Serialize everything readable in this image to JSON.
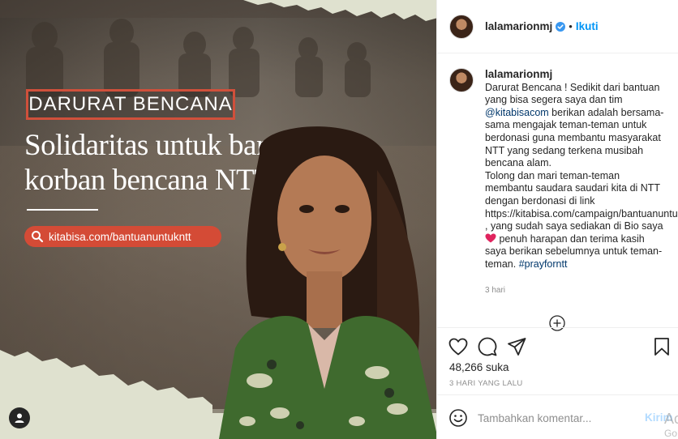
{
  "post": {
    "headline_tag": "DARURAT BENCANA",
    "headline_line1": "Solidaritas untuk bantu",
    "headline_line2": "korban bencana NTT",
    "link_pill": "kitabisa.com/bantuanuntukntt"
  },
  "header": {
    "username": "lalamarionmj",
    "separator": "•",
    "follow_label": "Ikuti"
  },
  "caption": {
    "username": "lalamarionmj",
    "text_part1": "Darurat Bencana ! Sedikit dari bantuan yang bisa segera saya dan tim ",
    "mention": "@kitabisacom",
    "text_part2": " berikan adalah bersama-sama mengajak teman-teman untuk berdonasi guna membantu masyarakat NTT yang sedang terkena musibah bencana alam.\nTolong dan mari teman-teman membantu saudara saudari kita di NTT dengan berdonasi di link https://kitabisa.com/campaign/bantuanuntukntt , yang sudah saya sediakan di Bio saya ",
    "text_part3": " penuh harapan dan terima kasih saya berikan sebelumnya untuk teman-teman. ",
    "hashtag": "#prayforntt",
    "time": "3 hari"
  },
  "engagement": {
    "likes": "48,266",
    "likes_suffix": " suka",
    "date": "3 HARI YANG LALU"
  },
  "composer": {
    "placeholder": "Tambahkan komentar...",
    "post_label": "Kirim"
  },
  "watermark": {
    "line1": "Ac",
    "line2": "Go"
  },
  "icons": {
    "verified": "verified-badge-icon",
    "search": "search-icon",
    "heart": "heart-icon",
    "comment": "comment-icon",
    "share": "share-icon",
    "save": "bookmark-icon",
    "emoji": "emoji-icon",
    "load_more": "plus-circle-icon",
    "user": "user-icon"
  },
  "colors": {
    "accent_link": "#0095f6",
    "headline_red": "#d44b36",
    "mention": "#00376b",
    "muted": "#8e8e8e"
  }
}
